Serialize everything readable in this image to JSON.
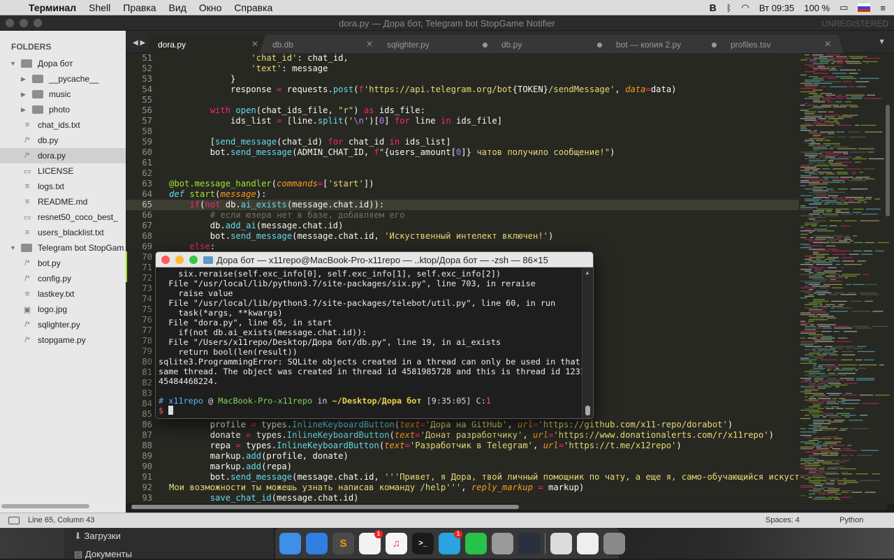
{
  "menubar": {
    "apple_icon": "",
    "app_name": "Терминал",
    "items": [
      "Shell",
      "Правка",
      "Вид",
      "Окно",
      "Справка"
    ],
    "status": {
      "vk_icon": "В",
      "clock": "Вт 09:35",
      "battery": "100 %"
    }
  },
  "window": {
    "title": "dora.py — Дора бот, Telegram bot StopGame Notifier",
    "unregistered": "UNREGISTERED"
  },
  "sidebar": {
    "header": "FOLDERS",
    "rows": [
      {
        "label": "Дора бот",
        "kind": "folder-open",
        "depth": 0
      },
      {
        "label": "__pycache__",
        "kind": "folder",
        "depth": 1
      },
      {
        "label": "music",
        "kind": "folder",
        "depth": 1
      },
      {
        "label": "photo",
        "kind": "folder",
        "depth": 1
      },
      {
        "label": "chat_ids.txt",
        "kind": "text",
        "depth": 1
      },
      {
        "label": "db.py",
        "kind": "code",
        "depth": 1
      },
      {
        "label": "dora.py",
        "kind": "code",
        "depth": 1,
        "selected": true
      },
      {
        "label": "LICENSE",
        "kind": "file",
        "depth": 1
      },
      {
        "label": "logs.txt",
        "kind": "text",
        "depth": 1
      },
      {
        "label": "README.md",
        "kind": "text",
        "depth": 1
      },
      {
        "label": "resnet50_coco_best_",
        "kind": "file",
        "depth": 1
      },
      {
        "label": "users_blacklist.txt",
        "kind": "text",
        "depth": 1
      },
      {
        "label": "Telegram bot StopGam",
        "kind": "folder-open",
        "depth": 0
      },
      {
        "label": "bot.py",
        "kind": "code",
        "depth": 1
      },
      {
        "label": "config.py",
        "kind": "code",
        "depth": 1
      },
      {
        "label": "lastkey.txt",
        "kind": "text",
        "depth": 1
      },
      {
        "label": "logo.jpg",
        "kind": "image",
        "depth": 1
      },
      {
        "label": "sqlighter.py",
        "kind": "code",
        "depth": 1
      },
      {
        "label": "stopgame.py",
        "kind": "code",
        "depth": 1
      }
    ]
  },
  "tabs": [
    {
      "label": "dora.py",
      "active": true,
      "close": "✕"
    },
    {
      "label": "db.db",
      "close": "✕"
    },
    {
      "label": "sqlighter.py",
      "dirty": true
    },
    {
      "label": "db.py",
      "dirty": true
    },
    {
      "label": "bot — копия 2.py",
      "dirty": true
    },
    {
      "label": "profiles.tsv",
      "close": "✕"
    }
  ],
  "editor": {
    "current_line": 65,
    "lines": [
      {
        "n": 51,
        "h": "                <span class=\"s\">'chat_id'</span>: chat_id,"
      },
      {
        "n": 52,
        "h": "                <span class=\"s\">'text'</span>: message"
      },
      {
        "n": 53,
        "h": "            }"
      },
      {
        "n": 54,
        "h": "            response <span class=\"k\">=</span> requests.<span class=\"f\">post</span>(<span class=\"k\">f</span><span class=\"s\">'https://api.telegram.org/bot</span>{TOKEN}<span class=\"s\">/sendMessage'</span>, <span class=\"p\">data</span><span class=\"k\">=</span>data)"
      },
      {
        "n": 55,
        "h": ""
      },
      {
        "n": 56,
        "h": "        <span class=\"k\">with</span> <span class=\"f\">open</span>(chat_ids_file, <span class=\"s\">\"r\"</span>) <span class=\"k\">as</span> ids_file:"
      },
      {
        "n": 57,
        "h": "            ids_list <span class=\"k\">=</span> [line.<span class=\"f\">split</span>(<span class=\"s\">'</span><span class=\"n\">\\n</span><span class=\"s\">'</span>)[<span class=\"n\">0</span>] <span class=\"k\">for</span> line <span class=\"k\">in</span> ids_file]"
      },
      {
        "n": 58,
        "h": ""
      },
      {
        "n": 59,
        "h": "        [<span class=\"f\">send_message</span>(chat_id) <span class=\"k\">for</span> chat_id <span class=\"k\">in</span> ids_list]"
      },
      {
        "n": 60,
        "h": "        bot.<span class=\"f\">send_message</span>(ADMIN_CHAT_ID, <span class=\"k\">f</span><span class=\"s\">\"</span>{users_amount[<span class=\"n\">0</span>]}<span class=\"s\"> чатов получило сообщение!\"</span>)"
      },
      {
        "n": 61,
        "h": ""
      },
      {
        "n": 62,
        "h": ""
      },
      {
        "n": 63,
        "h": "<span class=\"g\">@bot.message_handler</span>(<span class=\"p\">commands</span><span class=\"k\">=</span>[<span class=\"s\">'start'</span>])"
      },
      {
        "n": 64,
        "h": "<span class=\"f\" style=\"font-style:italic\">def</span> <span class=\"g\">start</span>(<span class=\"p\">message</span>):"
      },
      {
        "n": 65,
        "h": "    <span class=\"k\">if</span>(<span class=\"k\">not</span> db.<span class=\"f\">ai_exists</span>(message.chat.id)):"
      },
      {
        "n": 66,
        "h": "        <span class=\"c\"># если юзера нет в базе, добавляем его</span>"
      },
      {
        "n": 67,
        "h": "        db.<span class=\"f\">add_ai</span>(message.chat.id)"
      },
      {
        "n": 68,
        "h": "        bot.<span class=\"f\">send_message</span>(message.chat.id, <span class=\"s\">'Искуственный интелект включен!'</span>)"
      },
      {
        "n": 69,
        "h": "    <span class=\"k\">else</span>:"
      },
      {
        "n": 70,
        "h": ""
      },
      {
        "n": 71,
        "h": ""
      },
      {
        "n": 72,
        "h": ""
      },
      {
        "n": 73,
        "h": ""
      },
      {
        "n": 74,
        "h": ""
      },
      {
        "n": 75,
        "h": ""
      },
      {
        "n": 76,
        "h": ""
      },
      {
        "n": 77,
        "h": ""
      },
      {
        "n": 78,
        "h": ""
      },
      {
        "n": 79,
        "h": ""
      },
      {
        "n": 80,
        "h": ""
      },
      {
        "n": 81,
        "h": ""
      },
      {
        "n": 82,
        "h": ""
      },
      {
        "n": 83,
        "h": ""
      },
      {
        "n": 84,
        "h": ""
      },
      {
        "n": 85,
        "h": ""
      },
      {
        "n": 86,
        "h": "        profile <span class=\"k\">=</span> types.<span class=\"f\">InlineKeyboardButton</span>(<span class=\"p\">text</span><span class=\"k\">=</span><span class=\"s\">'Дора на GitHub'</span>, <span class=\"p\">url</span><span class=\"k\">=</span><span class=\"s\">'https://github.com/x11-repo/dorabot'</span>)"
      },
      {
        "n": 87,
        "h": "        donate <span class=\"k\">=</span> types.<span class=\"f\">InlineKeyboardButton</span>(<span class=\"p\">text</span><span class=\"k\">=</span><span class=\"s\">'Донат разработчику'</span>, <span class=\"p\">url</span><span class=\"k\">=</span><span class=\"s\">'https://www.donationalerts.com/r/x11repo'</span>)"
      },
      {
        "n": 88,
        "h": "        repa <span class=\"k\">=</span> types.<span class=\"f\">InlineKeyboardButton</span>(<span class=\"p\">text</span><span class=\"k\">=</span><span class=\"s\">'Разработчик в Telegram'</span>, <span class=\"p\">url</span><span class=\"k\">=</span><span class=\"s\">'https://t.me/x12repo'</span>)"
      },
      {
        "n": 89,
        "h": "        markup.<span class=\"f\">add</span>(profile, donate)"
      },
      {
        "n": 90,
        "h": "        markup.<span class=\"f\">add</span>(repa)"
      },
      {
        "n": 91,
        "h": "        bot.<span class=\"f\">send_message</span>(message.chat.id, <span class=\"s\">'''Привет, я Дора, твой личный помощник по чату, а еще я, само-обучающийся искуственный</span>"
      },
      {
        "n": 92,
        "h": "<span class=\"s\">Мои возможности ты можешь узнать написав команду /help'''</span>, <span class=\"p\">reply_markup</span> <span class=\"k\">=</span> markup)"
      },
      {
        "n": 93,
        "h": "        <span class=\"f\">save_chat_id</span>(message.chat.id)"
      }
    ]
  },
  "statusbar": {
    "position": "Line 65, Column 43",
    "spaces": "Spaces: 4",
    "syntax": "Python"
  },
  "terminal": {
    "title": "Дора бот — x11repo@MacBook-Pro-x11repo — ..ktop/Дора бот — -zsh — 86×15",
    "lines": [
      "    six.reraise(self.exc_info[0], self.exc_info[1], self.exc_info[2])",
      "  File \"/usr/local/lib/python3.7/site-packages/six.py\", line 703, in reraise",
      "    raise value",
      "  File \"/usr/local/lib/python3.7/site-packages/telebot/util.py\", line 60, in run",
      "    task(*args, **kwargs)",
      "  File \"dora.py\", line 65, in start",
      "    if(not db.ai_exists(message.chat.id)):",
      "  File \"/Users/x11repo/Desktop/Дора бот/db.py\", line 19, in ai_exists",
      "    return bool(len(result))",
      "sqlite3.ProgrammingError: SQLite objects created in a thread can only be used in that",
      "same thread. The object was created in thread id 4581985728 and this is thread id 1231",
      "45484468224.",
      ""
    ],
    "prompt": {
      "hash": "#",
      "user": "x11repo",
      "at": "@",
      "host": "MacBook-Pro-x11repo",
      "in": "in",
      "path": "~/Desktop/Дора бот",
      "time": "[9:35:05]",
      "code_label": "C:",
      "code": "1",
      "symbol": "$"
    }
  },
  "finder": {
    "items": [
      "Загрузки",
      "Документы"
    ]
  },
  "dock": {
    "apps": [
      {
        "name": "finder-icon",
        "color": "#3d8fe8"
      },
      {
        "name": "safari-icon",
        "color": "#2f7fe0"
      },
      {
        "name": "sublime-text-icon",
        "color": "#4a4a4a",
        "glyph": "S"
      },
      {
        "name": "reminders-icon",
        "color": "#f2f2f2",
        "badge": "1"
      },
      {
        "name": "music-icon",
        "color": "#f5f5f5",
        "glyph": "♫"
      },
      {
        "name": "terminal-icon",
        "color": "#1a1a1a",
        "glyph": ">_"
      },
      {
        "name": "telegram-icon",
        "color": "#2aa3e0",
        "badge": "1"
      },
      {
        "name": "whatsapp-icon",
        "color": "#28c24a"
      },
      {
        "name": "disk-utility-icon",
        "color": "#9a9a9a"
      },
      {
        "name": "app-icon",
        "color": "#2a3040"
      },
      {
        "name": "preview-icon",
        "color": "#dcdcdc"
      },
      {
        "name": "activity-icon",
        "color": "#eeeeee"
      },
      {
        "name": "trash-icon",
        "color": "#8a8a8a"
      }
    ]
  }
}
